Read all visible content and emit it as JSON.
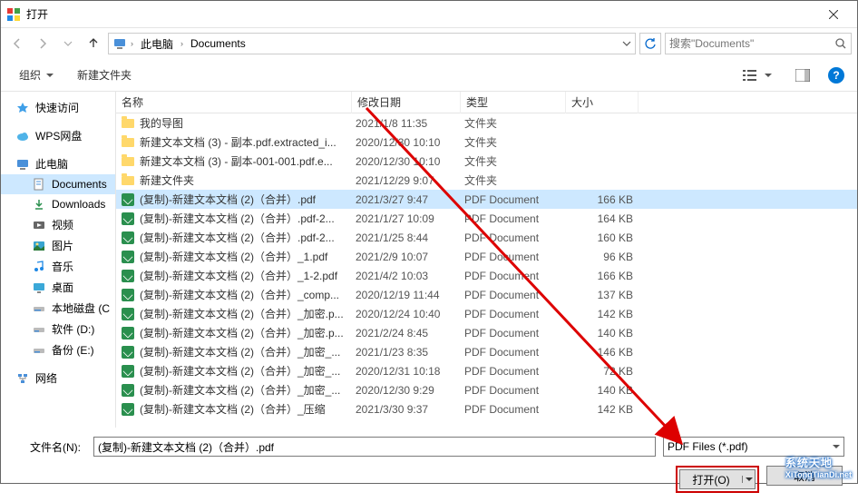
{
  "window": {
    "title": "打开"
  },
  "nav": {
    "breadcrumb": {
      "seg1": "此电脑",
      "seg2": "Documents"
    },
    "search_placeholder": "搜索\"Documents\""
  },
  "toolbar": {
    "organize": "组织",
    "new_folder": "新建文件夹"
  },
  "sidebar": {
    "quick_access": "快速访问",
    "wps": "WPS网盘",
    "this_pc": "此电脑",
    "documents": "Documents",
    "downloads": "Downloads",
    "videos": "视频",
    "pictures": "图片",
    "music": "音乐",
    "desktop": "桌面",
    "local_c": "本地磁盘 (C",
    "drive_d": "软件 (D:)",
    "drive_e": "备份 (E:)",
    "network": "网络"
  },
  "columns": {
    "name": "名称",
    "date": "修改日期",
    "type": "类型",
    "size": "大小"
  },
  "files": [
    {
      "icon": "folder",
      "name": "我的导图",
      "date": "2021/1/8 11:35",
      "type": "文件夹",
      "size": ""
    },
    {
      "icon": "folder",
      "name": "新建文本文档 (3) - 副本.pdf.extracted_i...",
      "date": "2020/12/30 10:10",
      "type": "文件夹",
      "size": ""
    },
    {
      "icon": "folder",
      "name": "新建文本文档 (3) - 副本-001-001.pdf.e...",
      "date": "2020/12/30 10:10",
      "type": "文件夹",
      "size": ""
    },
    {
      "icon": "folder",
      "name": "新建文件夹",
      "date": "2021/12/29 9:07",
      "type": "文件夹",
      "size": ""
    },
    {
      "icon": "pdf",
      "name": "(复制)-新建文本文档 (2)（合并）.pdf",
      "date": "2021/3/27 9:47",
      "type": "PDF Document",
      "size": "166 KB",
      "selected": true
    },
    {
      "icon": "pdf",
      "name": "(复制)-新建文本文档 (2)（合并）.pdf-2...",
      "date": "2021/1/27 10:09",
      "type": "PDF Document",
      "size": "164 KB"
    },
    {
      "icon": "pdf",
      "name": "(复制)-新建文本文档 (2)（合并）.pdf-2...",
      "date": "2021/1/25 8:44",
      "type": "PDF Document",
      "size": "160 KB"
    },
    {
      "icon": "pdf",
      "name": "(复制)-新建文本文档 (2)（合并）_1.pdf",
      "date": "2021/2/9 10:07",
      "type": "PDF Document",
      "size": "96 KB"
    },
    {
      "icon": "pdf",
      "name": "(复制)-新建文本文档 (2)（合并）_1-2.pdf",
      "date": "2021/4/2 10:03",
      "type": "PDF Document",
      "size": "166 KB"
    },
    {
      "icon": "pdf",
      "name": "(复制)-新建文本文档 (2)（合并）_comp...",
      "date": "2020/12/19 11:44",
      "type": "PDF Document",
      "size": "137 KB"
    },
    {
      "icon": "pdf",
      "name": "(复制)-新建文本文档 (2)（合并）_加密.p...",
      "date": "2020/12/24 10:40",
      "type": "PDF Document",
      "size": "142 KB"
    },
    {
      "icon": "pdf",
      "name": "(复制)-新建文本文档 (2)（合并）_加密.p...",
      "date": "2021/2/24 8:45",
      "type": "PDF Document",
      "size": "140 KB"
    },
    {
      "icon": "pdf",
      "name": "(复制)-新建文本文档 (2)（合并）_加密_...",
      "date": "2021/1/23 8:35",
      "type": "PDF Document",
      "size": "146 KB"
    },
    {
      "icon": "pdf",
      "name": "(复制)-新建文本文档 (2)（合并）_加密_...",
      "date": "2020/12/31 10:18",
      "type": "PDF Document",
      "size": "72 KB"
    },
    {
      "icon": "pdf",
      "name": "(复制)-新建文本文档 (2)（合并）_加密_...",
      "date": "2020/12/30 9:29",
      "type": "PDF Document",
      "size": "140 KB"
    },
    {
      "icon": "pdf",
      "name": "(复制)-新建文本文档 (2)（合并）_压缩",
      "date": "2021/3/30 9:37",
      "type": "PDF Document",
      "size": "142 KB"
    }
  ],
  "bottom": {
    "filename_label": "文件名(N):",
    "filename_value": "(复制)-新建文本文档 (2)（合并）.pdf",
    "filter": "PDF Files (*.pdf)",
    "open": "打开(O)",
    "cancel": "取消"
  },
  "watermark": {
    "main": "系统天地",
    "sub": "XiTongTianDi.net"
  }
}
